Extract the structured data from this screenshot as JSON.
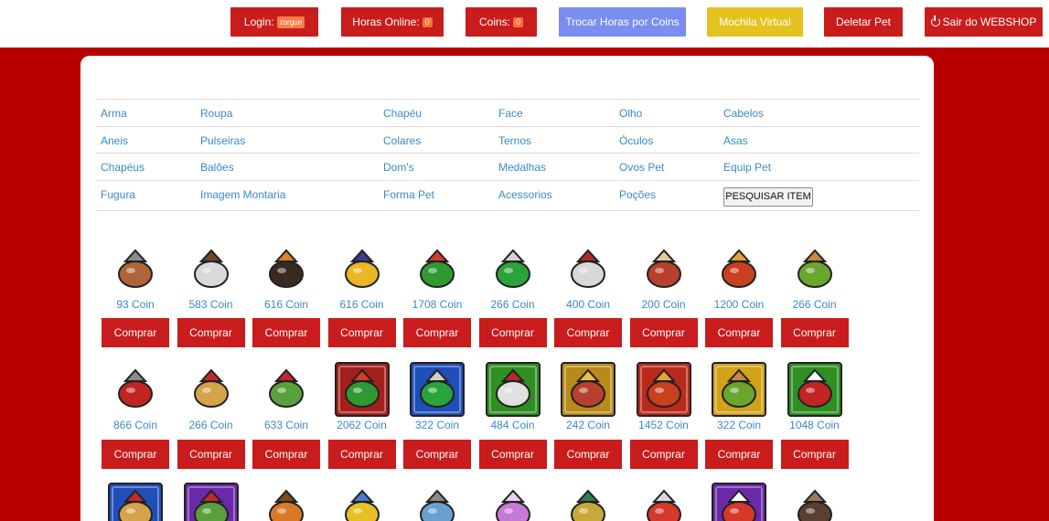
{
  "topbar": {
    "login_label": "Login:",
    "login_user": "zorgue",
    "hours_label": "Horas Online:",
    "hours_value": "0",
    "coins_label": "Coins:",
    "coins_value": "0",
    "trade_label": "Trocar Horas por Coins",
    "backpack_label": "Mochila Virtual",
    "delete_pet_label": "Deletar Pet",
    "logout_label": "Sair do WEBSHOP",
    "colors": {
      "red": "#c91c1c",
      "blue": "#7b8df0",
      "yellow": "#e6c21e"
    }
  },
  "categories": [
    [
      "Arma",
      "Roupa",
      "Chapéu",
      "Face",
      "Olho",
      "Cabelos"
    ],
    [
      "Aneis",
      "Pulseiras",
      "Colares",
      "Ternos",
      "Óculos",
      "Asas"
    ],
    [
      "Chapéus",
      "Balões",
      "Dom's",
      "Medalhas",
      "Ovos Pet",
      "Equip Pet"
    ],
    [
      "Fugura",
      "Imagem Montaria",
      "Forma Pet",
      "Acessorios",
      "Poções"
    ]
  ],
  "search_label": "PESQUISAR ITEM",
  "buy_label": "Comprar",
  "items_row1": [
    {
      "price": "93 Coin",
      "icon": "hammer-axe-icon"
    },
    {
      "price": "583 Coin",
      "icon": "bow-icon"
    },
    {
      "price": "616 Coin",
      "icon": "rifle-icon"
    },
    {
      "price": "616 Coin",
      "icon": "golden-gun-icon"
    },
    {
      "price": "1708 Coin",
      "icon": "flower-pot-icon"
    },
    {
      "price": "266 Coin",
      "icon": "green-sock-icon"
    },
    {
      "price": "400 Coin",
      "icon": "shuriken-icon"
    },
    {
      "price": "200 Coin",
      "icon": "pipe-icon"
    },
    {
      "price": "1200 Coin",
      "icon": "fruit-basket-icon"
    },
    {
      "price": "266 Coin",
      "icon": "salad-bowl-icon"
    }
  ],
  "items_row2": [
    {
      "price": "866 Coin",
      "icon": "medkit-icon"
    },
    {
      "price": "266 Coin",
      "icon": "drum-icon"
    },
    {
      "price": "633 Coin",
      "icon": "green-tv-icon"
    },
    {
      "price": "2062 Coin",
      "icon": "flower-pot-framed-icon"
    },
    {
      "price": "322 Coin",
      "icon": "sock-framed-icon"
    },
    {
      "price": "484 Coin",
      "icon": "shuriken-framed-icon"
    },
    {
      "price": "242 Coin",
      "icon": "pipe-framed-icon"
    },
    {
      "price": "1452 Coin",
      "icon": "fruit-basket-framed-icon"
    },
    {
      "price": "322 Coin",
      "icon": "salad-bowl-framed-icon"
    },
    {
      "price": "1048 Coin",
      "icon": "medkit-framed-icon"
    }
  ],
  "items_row3_icons": [
    "drum-framed-icon",
    "tv-framed-icon",
    "boomerang-icon",
    "golden-staff-icon",
    "crystal-mace-icon",
    "crystal-shard-icon",
    "golden-spear-icon",
    "red-car-icon",
    "red-car-framed-icon",
    "club-icon"
  ]
}
